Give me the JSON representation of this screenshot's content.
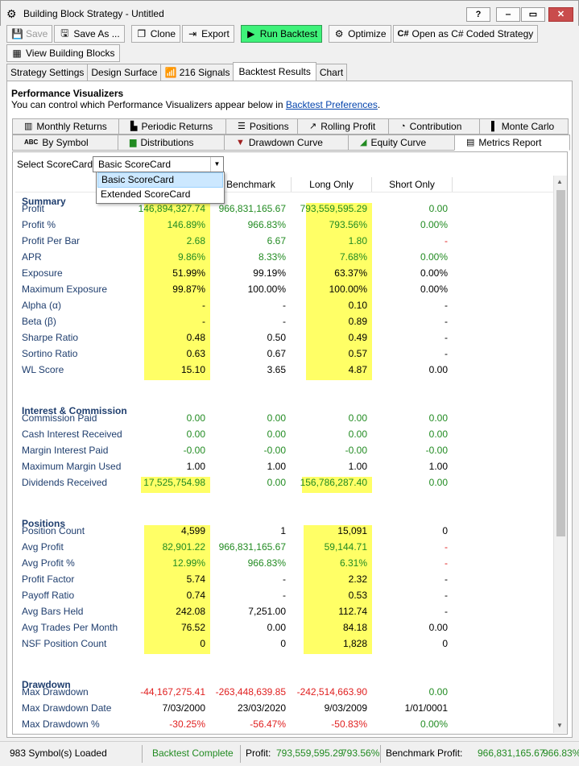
{
  "window": {
    "title": "Building Block Strategy - Untitled",
    "help": "?",
    "minimize": "‒",
    "maximize": "▭",
    "close": "✕"
  },
  "toolbar": {
    "save": "Save",
    "save_as": "Save As ...",
    "clone": "Clone",
    "export": "Export",
    "run_backtest": "Run Backtest",
    "optimize": "Optimize",
    "open_csharp": "Open as C# Coded Strategy",
    "view_building_blocks": "View Building Blocks"
  },
  "main_tabs": [
    "Strategy Settings",
    "Design Surface",
    "216 Signals",
    "Backtest Results",
    "Chart"
  ],
  "performance": {
    "title": "Performance Visualizers",
    "desc_prefix": "You can control which Performance Visualizers appear below in ",
    "desc_link": "Backtest Preferences",
    "desc_suffix": "."
  },
  "vis_tabs_row1": [
    "Monthly Returns",
    "Periodic Returns",
    "Positions",
    "Rolling Profit",
    "Contribution",
    "Monte Carlo"
  ],
  "vis_tabs_row2": [
    "By Symbol",
    "Distributions",
    "Drawdown Curve",
    "Equity Curve",
    "Metrics Report"
  ],
  "scorecard": {
    "label": "Select ScoreCard:",
    "selected": "Basic ScoreCard",
    "options": [
      "Basic ScoreCard",
      "Extended ScoreCard"
    ]
  },
  "columns": [
    "Benchmark",
    "Long Only",
    "Short Only"
  ],
  "sections": {
    "summary": "Summary",
    "interest": "Interest & Commission",
    "positions": "Positions",
    "drawdown": "Drawdown"
  },
  "rows": [
    {
      "label": "Profit",
      "v": [
        "146,894,327.74",
        "966,831,165.67",
        "793,559,595.29",
        "0.00"
      ],
      "c": [
        "pos",
        "pos",
        "pos",
        "pos"
      ]
    },
    {
      "label": "Profit %",
      "v": [
        "146.89%",
        "966.83%",
        "793.56%",
        "0.00%"
      ],
      "c": [
        "pos",
        "pos",
        "pos",
        "pos"
      ]
    },
    {
      "label": "Profit Per Bar",
      "v": [
        "2.68",
        "6.67",
        "1.80",
        "-"
      ],
      "c": [
        "pos",
        "pos",
        "pos",
        "neg"
      ]
    },
    {
      "label": "APR",
      "v": [
        "9.86%",
        "8.33%",
        "7.68%",
        "0.00%"
      ],
      "c": [
        "pos",
        "pos",
        "pos",
        "pos"
      ]
    },
    {
      "label": "Exposure",
      "v": [
        "51.99%",
        "99.19%",
        "63.37%",
        "0.00%"
      ],
      "c": [
        "nrm",
        "nrm",
        "nrm",
        "nrm"
      ]
    },
    {
      "label": "Maximum Exposure",
      "v": [
        "99.87%",
        "100.00%",
        "100.00%",
        "0.00%"
      ],
      "c": [
        "nrm",
        "nrm",
        "nrm",
        "nrm"
      ]
    },
    {
      "label": "Alpha (α)",
      "v": [
        "-",
        "-",
        "0.10",
        "-"
      ],
      "c": [
        "nrm",
        "nrm",
        "nrm",
        "nrm"
      ]
    },
    {
      "label": "Beta (β)",
      "v": [
        "-",
        "-",
        "0.89",
        "-"
      ],
      "c": [
        "nrm",
        "nrm",
        "nrm",
        "nrm"
      ]
    },
    {
      "label": "Sharpe Ratio",
      "v": [
        "0.48",
        "0.50",
        "0.49",
        "-"
      ],
      "c": [
        "nrm",
        "nrm",
        "nrm",
        "nrm"
      ]
    },
    {
      "label": "Sortino Ratio",
      "v": [
        "0.63",
        "0.67",
        "0.57",
        "-"
      ],
      "c": [
        "nrm",
        "nrm",
        "nrm",
        "nrm"
      ]
    },
    {
      "label": "WL Score",
      "v": [
        "15.10",
        "3.65",
        "4.87",
        "0.00"
      ],
      "c": [
        "nrm",
        "nrm",
        "nrm",
        "nrm"
      ]
    },
    {
      "label": "Commission Paid",
      "v": [
        "0.00",
        "0.00",
        "0.00",
        "0.00"
      ],
      "c": [
        "pos",
        "pos",
        "pos",
        "pos"
      ]
    },
    {
      "label": "Cash Interest Received",
      "v": [
        "0.00",
        "0.00",
        "0.00",
        "0.00"
      ],
      "c": [
        "pos",
        "pos",
        "pos",
        "pos"
      ]
    },
    {
      "label": "Margin Interest Paid",
      "v": [
        "-0.00",
        "-0.00",
        "-0.00",
        "-0.00"
      ],
      "c": [
        "pos",
        "pos",
        "pos",
        "pos"
      ]
    },
    {
      "label": "Maximum Margin Used",
      "v": [
        "1.00",
        "1.00",
        "1.00",
        "1.00"
      ],
      "c": [
        "nrm",
        "nrm",
        "nrm",
        "nrm"
      ]
    },
    {
      "label": "Dividends Received",
      "v": [
        "17,525,754.98",
        "0.00",
        "156,786,287.40",
        "0.00"
      ],
      "c": [
        "pos",
        "pos",
        "pos",
        "pos"
      ]
    },
    {
      "label": "Position Count",
      "v": [
        "4,599",
        "1",
        "15,091",
        "0"
      ],
      "c": [
        "nrm",
        "nrm",
        "nrm",
        "nrm"
      ]
    },
    {
      "label": "Avg Profit",
      "v": [
        "82,901.22",
        "966,831,165.67",
        "59,144.71",
        "-"
      ],
      "c": [
        "pos",
        "pos",
        "pos",
        "neg"
      ]
    },
    {
      "label": "Avg Profit %",
      "v": [
        "12.99%",
        "966.83%",
        "6.31%",
        "-"
      ],
      "c": [
        "pos",
        "pos",
        "pos",
        "neg"
      ]
    },
    {
      "label": "Profit Factor",
      "v": [
        "5.74",
        "-",
        "2.32",
        "-"
      ],
      "c": [
        "nrm",
        "nrm",
        "nrm",
        "nrm"
      ]
    },
    {
      "label": "Payoff Ratio",
      "v": [
        "0.74",
        "-",
        "0.53",
        "-"
      ],
      "c": [
        "nrm",
        "nrm",
        "nrm",
        "nrm"
      ]
    },
    {
      "label": "Avg Bars Held",
      "v": [
        "242.08",
        "7,251.00",
        "112.74",
        "-"
      ],
      "c": [
        "nrm",
        "nrm",
        "nrm",
        "nrm"
      ]
    },
    {
      "label": "Avg Trades Per Month",
      "v": [
        "76.52",
        "0.00",
        "84.18",
        "0.00"
      ],
      "c": [
        "nrm",
        "nrm",
        "nrm",
        "nrm"
      ]
    },
    {
      "label": "NSF Position Count",
      "v": [
        "0",
        "0",
        "1,828",
        "0"
      ],
      "c": [
        "nrm",
        "nrm",
        "nrm",
        "nrm"
      ]
    },
    {
      "label": "Max Drawdown",
      "v": [
        "-44,167,275.41",
        "-263,448,639.85",
        "-242,514,663.90",
        "0.00"
      ],
      "c": [
        "neg",
        "neg",
        "neg",
        "pos"
      ]
    },
    {
      "label": "Max Drawdown Date",
      "v": [
        "7/03/2000",
        "23/03/2020",
        "9/03/2009",
        "1/01/0001"
      ],
      "c": [
        "nrm",
        "nrm",
        "nrm",
        "nrm"
      ]
    },
    {
      "label": "Max Drawdown %",
      "v": [
        "-30.25%",
        "-56.47%",
        "-50.83%",
        "0.00%"
      ],
      "c": [
        "neg",
        "neg",
        "neg",
        "pos"
      ]
    }
  ],
  "status": {
    "symbols": "983 Symbol(s) Loaded",
    "state": "Backtest Complete",
    "profit_label": "Profit:",
    "profit_value": "793,559,595.29",
    "profit_pct": "793.56%",
    "bench_label": "Benchmark Profit:",
    "bench_value": "966,831,165.67",
    "bench_pct": "966.83%"
  },
  "colors": {
    "highlight": "#ffff66",
    "positive": "#228b22",
    "negative": "#e02020",
    "label": "#1f3e6e",
    "run": "#3ff27a"
  }
}
